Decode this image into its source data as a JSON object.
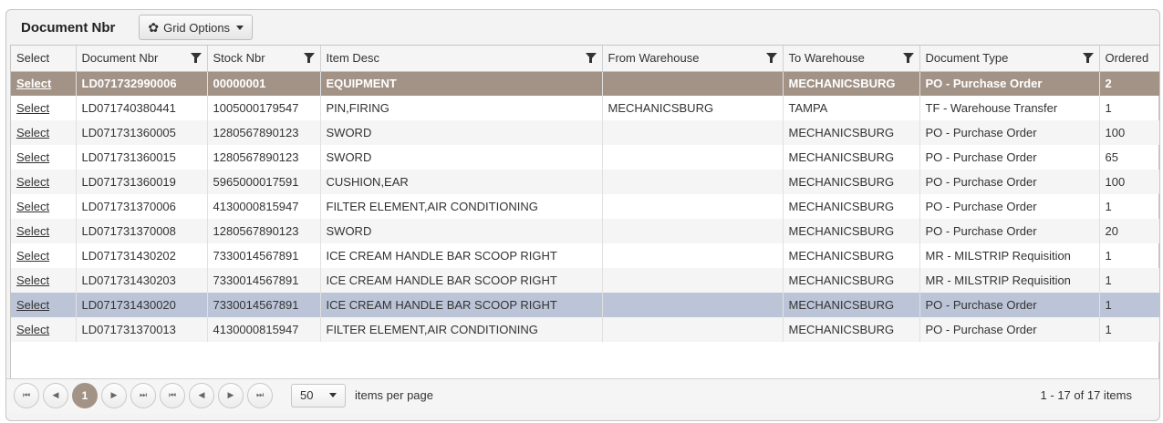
{
  "panel": {
    "title": "Document Nbr",
    "grid_options_label": "Grid Options"
  },
  "columns": [
    {
      "label": "Select",
      "filter": false
    },
    {
      "label": "Document Nbr",
      "filter": true
    },
    {
      "label": "Stock Nbr",
      "filter": true
    },
    {
      "label": "Item Desc",
      "filter": true
    },
    {
      "label": "From Warehouse",
      "filter": true
    },
    {
      "label": "To Warehouse",
      "filter": true
    },
    {
      "label": "Document Type",
      "filter": true
    },
    {
      "label": "Ordered",
      "filter": false
    }
  ],
  "rows": [
    {
      "select": "Select",
      "doc": "LD071732990006",
      "stock": "00000001",
      "desc": "EQUIPMENT",
      "from": "",
      "to": "MECHANICSBURG",
      "type": "PO - Purchase Order",
      "ordered": "2"
    },
    {
      "select": "Select",
      "doc": "LD071740380441",
      "stock": "1005000179547",
      "desc": "PIN,FIRING",
      "from": "MECHANICSBURG",
      "to": "TAMPA",
      "type": "TF - Warehouse Transfer",
      "ordered": "1"
    },
    {
      "select": "Select",
      "doc": "LD071731360005",
      "stock": "1280567890123",
      "desc": "SWORD",
      "from": "",
      "to": "MECHANICSBURG",
      "type": "PO - Purchase Order",
      "ordered": "100"
    },
    {
      "select": "Select",
      "doc": "LD071731360015",
      "stock": "1280567890123",
      "desc": "SWORD",
      "from": "",
      "to": "MECHANICSBURG",
      "type": "PO - Purchase Order",
      "ordered": "65"
    },
    {
      "select": "Select",
      "doc": "LD071731360019",
      "stock": "5965000017591",
      "desc": "CUSHION,EAR",
      "from": "",
      "to": "MECHANICSBURG",
      "type": "PO - Purchase Order",
      "ordered": "100"
    },
    {
      "select": "Select",
      "doc": "LD071731370006",
      "stock": "4130000815947",
      "desc": "FILTER ELEMENT,AIR CONDITIONING",
      "from": "",
      "to": "MECHANICSBURG",
      "type": "PO - Purchase Order",
      "ordered": "1"
    },
    {
      "select": "Select",
      "doc": "LD071731370008",
      "stock": "1280567890123",
      "desc": "SWORD",
      "from": "",
      "to": "MECHANICSBURG",
      "type": "PO - Purchase Order",
      "ordered": "20"
    },
    {
      "select": "Select",
      "doc": "LD071731430202",
      "stock": "7330014567891",
      "desc": "ICE CREAM HANDLE BAR SCOOP RIGHT",
      "from": "",
      "to": "MECHANICSBURG",
      "type": "MR - MILSTRIP Requisition",
      "ordered": "1"
    },
    {
      "select": "Select",
      "doc": "LD071731430203",
      "stock": "7330014567891",
      "desc": "ICE CREAM HANDLE BAR SCOOP RIGHT",
      "from": "",
      "to": "MECHANICSBURG",
      "type": "MR - MILSTRIP Requisition",
      "ordered": "1"
    },
    {
      "select": "Select",
      "doc": "LD071731430020",
      "stock": "7330014567891",
      "desc": "ICE CREAM HANDLE BAR SCOOP RIGHT",
      "from": "",
      "to": "MECHANICSBURG",
      "type": "PO - Purchase Order",
      "ordered": "1"
    },
    {
      "select": "Select",
      "doc": "LD071731370013",
      "stock": "4130000815947",
      "desc": "FILTER ELEMENT,AIR CONDITIONING",
      "from": "",
      "to": "MECHANICSBURG",
      "type": "PO - Purchase Order",
      "ordered": "1"
    }
  ],
  "pager": {
    "current_page": "1",
    "page_size": "50",
    "items_per_page_label": "items per page",
    "info": "1 - 17 of 17 items"
  },
  "colors": {
    "selected_row": "#a39387",
    "highlight_row": "#bcc5d8"
  }
}
